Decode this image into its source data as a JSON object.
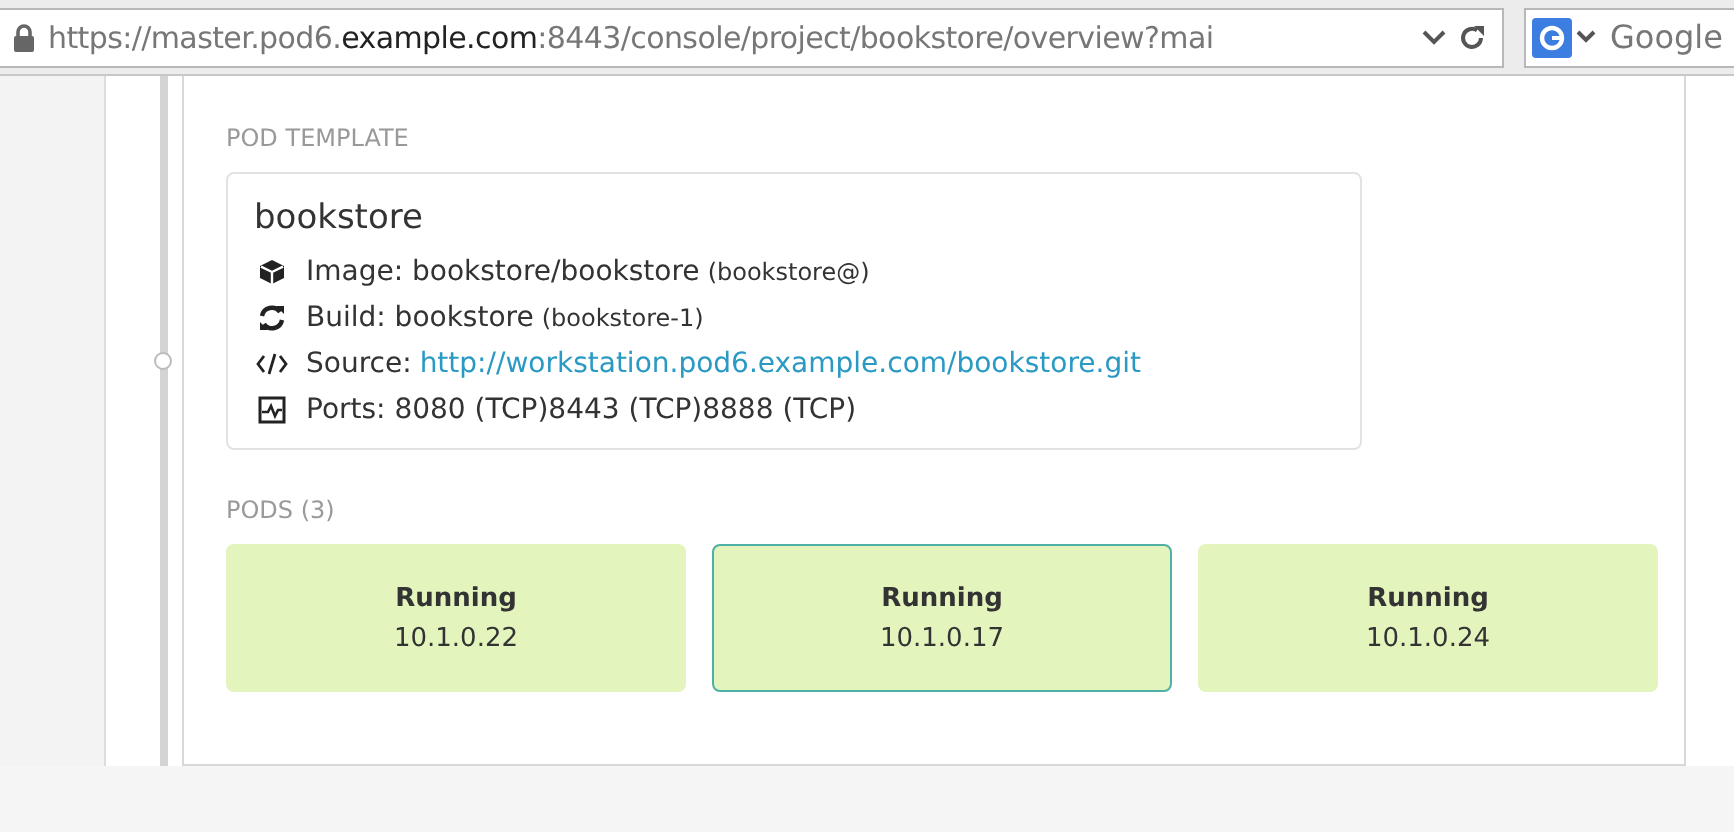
{
  "browser": {
    "address": [
      {
        "text": "https://master.pod6.",
        "strong": false
      },
      {
        "text": "example.com",
        "strong": true
      },
      {
        "text": ":8443/console/project/bookstore/overview?mai",
        "strong": false
      }
    ],
    "search_placeholder": "Google"
  },
  "pod_template": {
    "heading": "POD TEMPLATE",
    "name": "bookstore",
    "details": [
      {
        "kind": "image",
        "label": "Image: bookstore/bookstore",
        "note": "(bookstore@)"
      },
      {
        "kind": "build",
        "label": "Build: bookstore",
        "note": "(bookstore-1)"
      },
      {
        "kind": "source",
        "label": "Source:",
        "link": "http://workstation.pod6.example.com/bookstore.git"
      },
      {
        "kind": "ports",
        "label": "Ports: 8080 (TCP)8443 (TCP)8888 (TCP)"
      }
    ]
  },
  "pods": {
    "heading": "PODS (3)",
    "items": [
      {
        "status": "Running",
        "ip": "10.1.0.22",
        "selected": false
      },
      {
        "status": "Running",
        "ip": "10.1.0.17",
        "selected": true
      },
      {
        "status": "Running",
        "ip": "10.1.0.24",
        "selected": false
      }
    ]
  }
}
